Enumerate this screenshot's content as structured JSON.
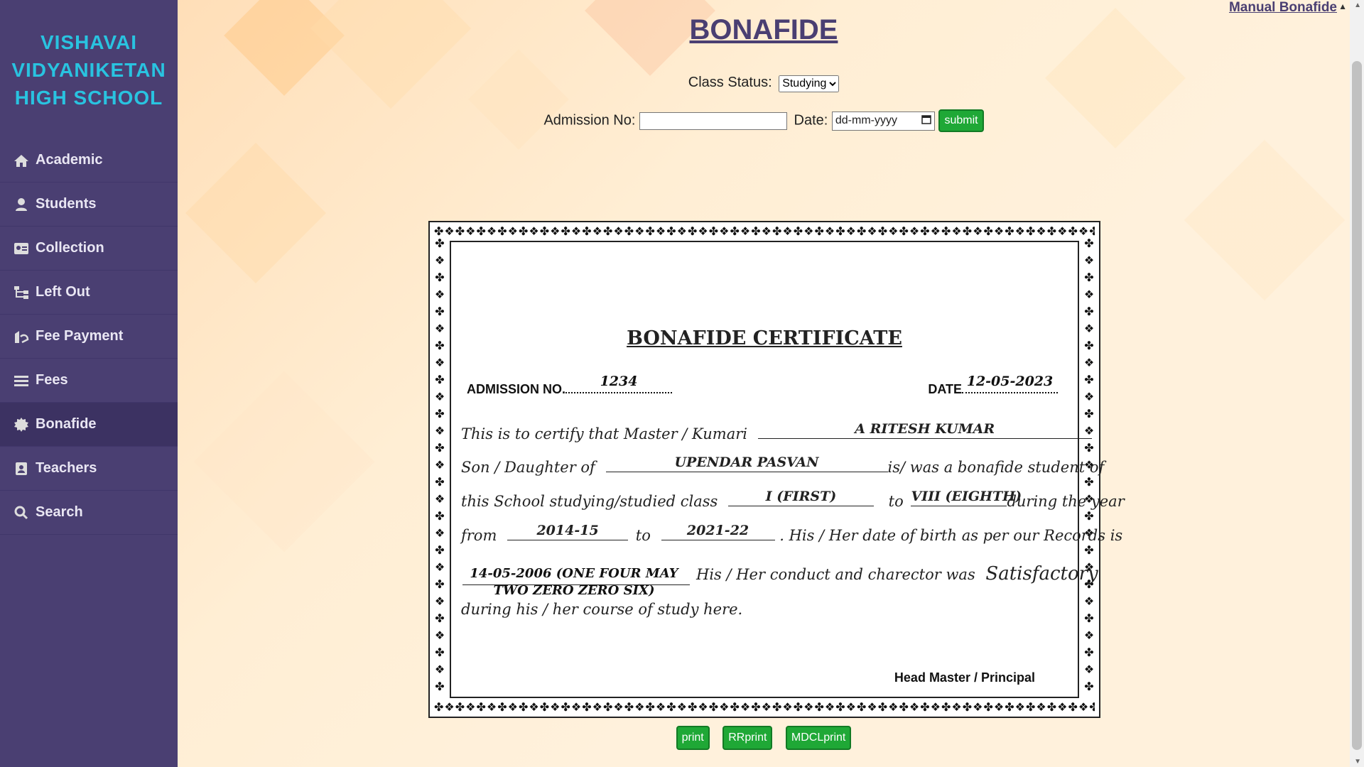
{
  "sidebar": {
    "school_name": "VISHAVAI VIDYANIKETAN HIGH SCHOOL",
    "items": [
      {
        "label": "Academic",
        "icon": "home-icon"
      },
      {
        "label": "Students",
        "icon": "user-icon"
      },
      {
        "label": "Collection",
        "icon": "id-card-icon"
      },
      {
        "label": "Left Out",
        "icon": "sitemap-icon"
      },
      {
        "label": "Fee Payment",
        "icon": "payment-icon"
      },
      {
        "label": "Fees",
        "icon": "list-icon"
      },
      {
        "label": "Bonafide",
        "icon": "certificate-icon",
        "active": true
      },
      {
        "label": "Teachers",
        "icon": "badge-icon"
      },
      {
        "label": "Search",
        "icon": "search-icon"
      }
    ]
  },
  "header": {
    "title": "BONAFIDE",
    "manual_link": "Manual Bonafide"
  },
  "form": {
    "class_status_label": "Class Status:",
    "class_status_value": "Studying",
    "admission_label": "Admission No:",
    "admission_value": "",
    "date_label": "Date:",
    "date_placeholder": "dd-mm-yyyy",
    "submit_label": "submit"
  },
  "certificate": {
    "title": "BONAFIDE CERTIFICATE",
    "admission_label": "ADMISSION NO.",
    "admission_no": "1234",
    "date_label": "DATE",
    "date_value": "12-05-2023",
    "line1_prefix": "This is to certify that Master / Kumari",
    "student_name": "A RITESH KUMAR",
    "line2_prefix": "Son / Daughter of",
    "parent_name": "UPENDAR PASVAN",
    "line2_suffix": "is/ was a bonafide student of",
    "line3_prefix": "this School studying/studied class",
    "class_from": "I (FIRST)",
    "to_word": "to",
    "class_to": "VIII (EIGHTH)",
    "line3_suffix": "during the year",
    "from_word": "from",
    "year_from": "2014-15",
    "year_to": "2021-22",
    "line4_suffix": ". His / Her date of birth as per our Records is",
    "dob": "14-05-2006 (ONE FOUR MAY TWO ZERO ZERO SIX)",
    "line5_text": "His / Her  conduct and charector was",
    "conduct": "Satisfactory",
    "line6_text": "during his / her course of study here.",
    "signature": "Head Master / Principal"
  },
  "buttons": {
    "print": "print",
    "rrprint": "RRprint",
    "mdclprint": "MDCLprint"
  }
}
